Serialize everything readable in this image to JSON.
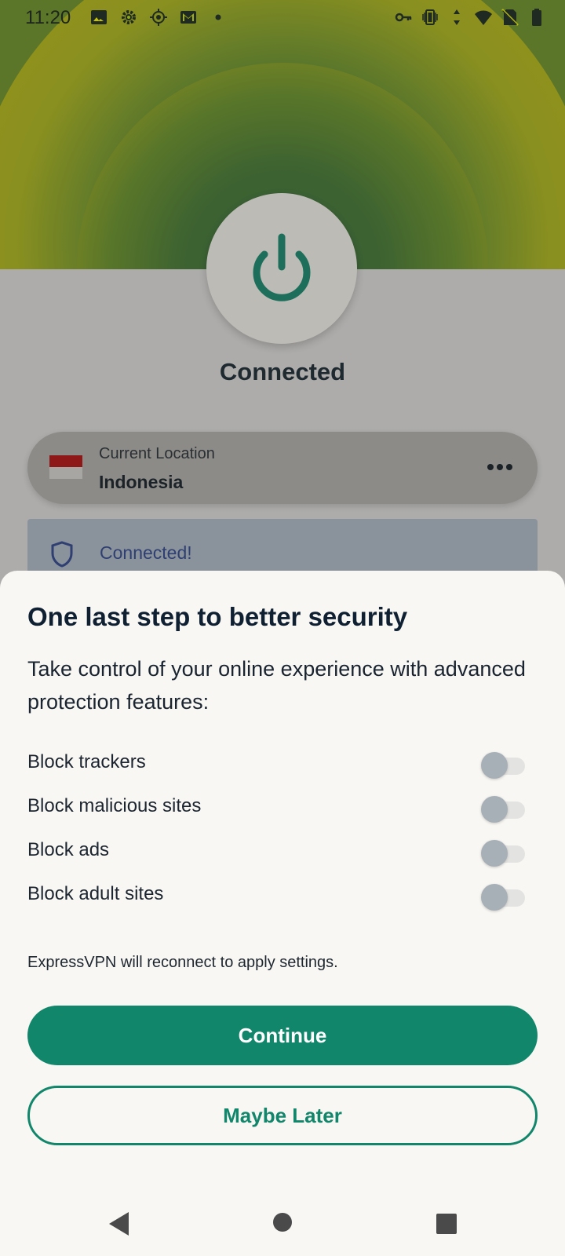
{
  "status_bar": {
    "time": "11:20",
    "left_icons": [
      "image-icon",
      "settings-icon",
      "location-icon",
      "gmail-icon",
      "dot-icon"
    ],
    "right_icons": [
      "vpn-key-icon",
      "vibrate-icon",
      "data-arrows-icon",
      "wifi-icon",
      "no-sim-icon",
      "battery-icon"
    ]
  },
  "vpn": {
    "status": "Connected",
    "location_caption": "Current Location",
    "location_value": "Indonesia",
    "banner_text": "Connected!"
  },
  "sheet": {
    "title": "One last step to better security",
    "intro": "Take control of your online experience with advanced protection features:",
    "options": [
      {
        "label": "Block trackers",
        "enabled": false
      },
      {
        "label": "Block malicious sites",
        "enabled": false
      },
      {
        "label": "Block ads",
        "enabled": false
      },
      {
        "label": "Block adult sites",
        "enabled": false
      }
    ],
    "note": "ExpressVPN will reconnect to apply settings.",
    "continue_label": "Continue",
    "later_label": "Maybe Later"
  },
  "colors": {
    "accent": "#12866b",
    "power_icon": "#1d6f5b",
    "banner_text": "#2f3f72"
  }
}
